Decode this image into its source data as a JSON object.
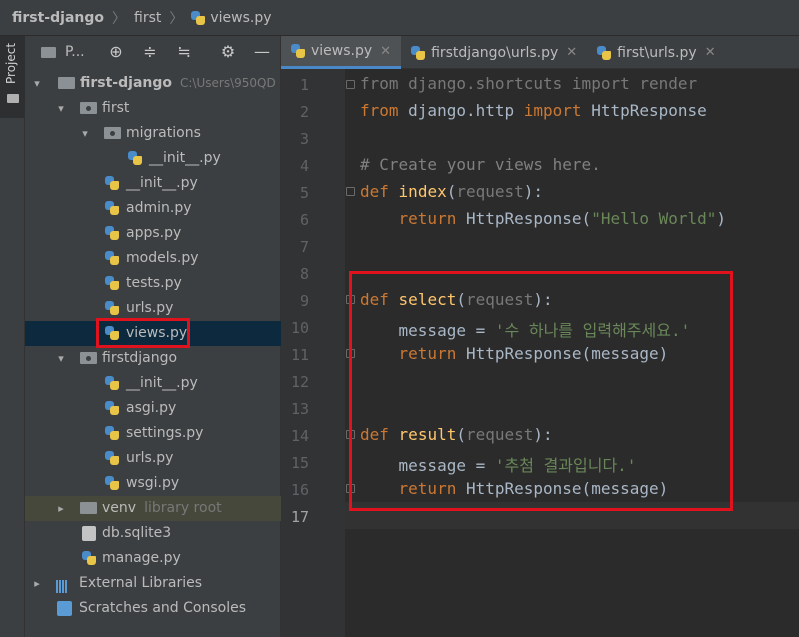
{
  "breadcrumb": [
    "first-django",
    "first",
    "views.py"
  ],
  "sidebar_strip": {
    "label": "Project"
  },
  "project_panel": {
    "title": "P...",
    "icons": [
      "locate-icon",
      "expand-all-icon",
      "collapse-all-icon",
      "settings-icon",
      "hide-icon"
    ]
  },
  "tree": {
    "root": {
      "label": "first-django",
      "path": "C:\\Users\\950QD"
    },
    "first": "first",
    "migrations": "migrations",
    "mig_init": "__init__.py",
    "first_init": "__init__.py",
    "admin": "admin.py",
    "apps": "apps.py",
    "models": "models.py",
    "tests": "tests.py",
    "urls": "urls.py",
    "views": "views.py",
    "firstdjango": "firstdjango",
    "fd_init": "__init__.py",
    "asgi": "asgi.py",
    "settings": "settings.py",
    "fd_urls": "urls.py",
    "wsgi": "wsgi.py",
    "venv": {
      "label": "venv",
      "hint": "library root"
    },
    "db": "db.sqlite3",
    "manage": "manage.py",
    "external": "External Libraries",
    "scratches": "Scratches and Consoles"
  },
  "tabs": [
    {
      "label": "views.py",
      "active": true
    },
    {
      "label": "firstdjango\\urls.py",
      "active": false
    },
    {
      "label": "first\\urls.py",
      "active": false
    }
  ],
  "editor": {
    "line_numbers": [
      "1",
      "2",
      "3",
      "4",
      "5",
      "6",
      "7",
      "8",
      "9",
      "10",
      "11",
      "12",
      "13",
      "14",
      "15",
      "16",
      "17"
    ],
    "current_line": "17",
    "code": {
      "l1": [
        "from",
        " django.shortcuts ",
        "import",
        " render"
      ],
      "l2": [
        "from",
        " django.http ",
        "import",
        " HttpResponse"
      ],
      "l4": "# Create your views here.",
      "l5": [
        "def",
        " ",
        "index",
        "(",
        "request",
        "):"
      ],
      "l6": [
        "    ",
        "return",
        " HttpResponse(",
        "\"Hello World\"",
        ")"
      ],
      "l9": [
        "def",
        " ",
        "select",
        "(",
        "request",
        "):"
      ],
      "l10": [
        "    message = ",
        "'수 하나를 입력해주세요.'"
      ],
      "l11": [
        "    ",
        "return",
        " HttpResponse(message)"
      ],
      "l14": [
        "def",
        " ",
        "result",
        "(",
        "request",
        "):"
      ],
      "l15": [
        "    message = ",
        "'추첨 결과입니다.'"
      ],
      "l16": [
        "    ",
        "return",
        " HttpResponse(message)"
      ]
    }
  },
  "colors": {
    "keyword": "#cc7832",
    "function": "#ffc66d",
    "string": "#6a8759",
    "comment": "#808080",
    "highlight_box": "#e0121e"
  }
}
